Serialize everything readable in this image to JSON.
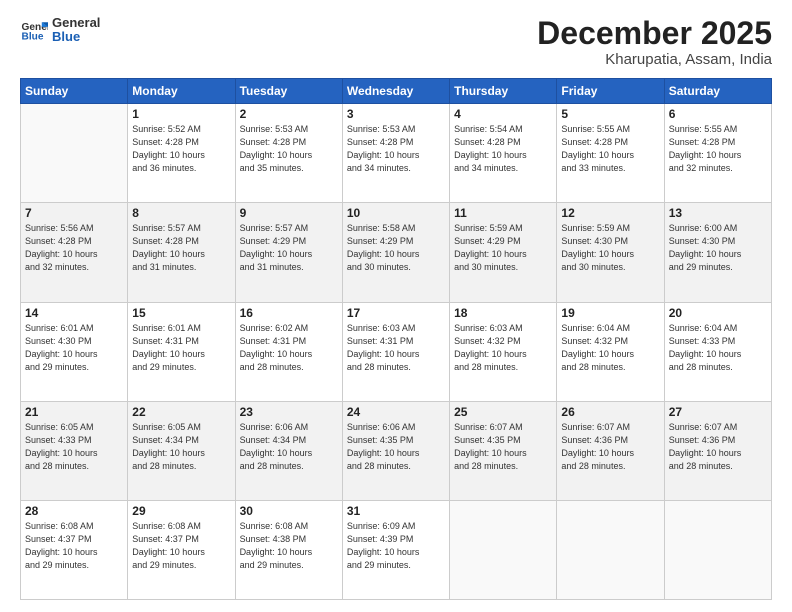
{
  "logo": {
    "line1": "General",
    "line2": "Blue"
  },
  "header": {
    "month": "December 2025",
    "location": "Kharupatia, Assam, India"
  },
  "weekdays": [
    "Sunday",
    "Monday",
    "Tuesday",
    "Wednesday",
    "Thursday",
    "Friday",
    "Saturday"
  ],
  "weeks": [
    [
      {
        "day": "",
        "info": ""
      },
      {
        "day": "1",
        "info": "Sunrise: 5:52 AM\nSunset: 4:28 PM\nDaylight: 10 hours\nand 36 minutes."
      },
      {
        "day": "2",
        "info": "Sunrise: 5:53 AM\nSunset: 4:28 PM\nDaylight: 10 hours\nand 35 minutes."
      },
      {
        "day": "3",
        "info": "Sunrise: 5:53 AM\nSunset: 4:28 PM\nDaylight: 10 hours\nand 34 minutes."
      },
      {
        "day": "4",
        "info": "Sunrise: 5:54 AM\nSunset: 4:28 PM\nDaylight: 10 hours\nand 34 minutes."
      },
      {
        "day": "5",
        "info": "Sunrise: 5:55 AM\nSunset: 4:28 PM\nDaylight: 10 hours\nand 33 minutes."
      },
      {
        "day": "6",
        "info": "Sunrise: 5:55 AM\nSunset: 4:28 PM\nDaylight: 10 hours\nand 32 minutes."
      }
    ],
    [
      {
        "day": "7",
        "info": "Sunrise: 5:56 AM\nSunset: 4:28 PM\nDaylight: 10 hours\nand 32 minutes."
      },
      {
        "day": "8",
        "info": "Sunrise: 5:57 AM\nSunset: 4:28 PM\nDaylight: 10 hours\nand 31 minutes."
      },
      {
        "day": "9",
        "info": "Sunrise: 5:57 AM\nSunset: 4:29 PM\nDaylight: 10 hours\nand 31 minutes."
      },
      {
        "day": "10",
        "info": "Sunrise: 5:58 AM\nSunset: 4:29 PM\nDaylight: 10 hours\nand 30 minutes."
      },
      {
        "day": "11",
        "info": "Sunrise: 5:59 AM\nSunset: 4:29 PM\nDaylight: 10 hours\nand 30 minutes."
      },
      {
        "day": "12",
        "info": "Sunrise: 5:59 AM\nSunset: 4:30 PM\nDaylight: 10 hours\nand 30 minutes."
      },
      {
        "day": "13",
        "info": "Sunrise: 6:00 AM\nSunset: 4:30 PM\nDaylight: 10 hours\nand 29 minutes."
      }
    ],
    [
      {
        "day": "14",
        "info": "Sunrise: 6:01 AM\nSunset: 4:30 PM\nDaylight: 10 hours\nand 29 minutes."
      },
      {
        "day": "15",
        "info": "Sunrise: 6:01 AM\nSunset: 4:31 PM\nDaylight: 10 hours\nand 29 minutes."
      },
      {
        "day": "16",
        "info": "Sunrise: 6:02 AM\nSunset: 4:31 PM\nDaylight: 10 hours\nand 28 minutes."
      },
      {
        "day": "17",
        "info": "Sunrise: 6:03 AM\nSunset: 4:31 PM\nDaylight: 10 hours\nand 28 minutes."
      },
      {
        "day": "18",
        "info": "Sunrise: 6:03 AM\nSunset: 4:32 PM\nDaylight: 10 hours\nand 28 minutes."
      },
      {
        "day": "19",
        "info": "Sunrise: 6:04 AM\nSunset: 4:32 PM\nDaylight: 10 hours\nand 28 minutes."
      },
      {
        "day": "20",
        "info": "Sunrise: 6:04 AM\nSunset: 4:33 PM\nDaylight: 10 hours\nand 28 minutes."
      }
    ],
    [
      {
        "day": "21",
        "info": "Sunrise: 6:05 AM\nSunset: 4:33 PM\nDaylight: 10 hours\nand 28 minutes."
      },
      {
        "day": "22",
        "info": "Sunrise: 6:05 AM\nSunset: 4:34 PM\nDaylight: 10 hours\nand 28 minutes."
      },
      {
        "day": "23",
        "info": "Sunrise: 6:06 AM\nSunset: 4:34 PM\nDaylight: 10 hours\nand 28 minutes."
      },
      {
        "day": "24",
        "info": "Sunrise: 6:06 AM\nSunset: 4:35 PM\nDaylight: 10 hours\nand 28 minutes."
      },
      {
        "day": "25",
        "info": "Sunrise: 6:07 AM\nSunset: 4:35 PM\nDaylight: 10 hours\nand 28 minutes."
      },
      {
        "day": "26",
        "info": "Sunrise: 6:07 AM\nSunset: 4:36 PM\nDaylight: 10 hours\nand 28 minutes."
      },
      {
        "day": "27",
        "info": "Sunrise: 6:07 AM\nSunset: 4:36 PM\nDaylight: 10 hours\nand 28 minutes."
      }
    ],
    [
      {
        "day": "28",
        "info": "Sunrise: 6:08 AM\nSunset: 4:37 PM\nDaylight: 10 hours\nand 29 minutes."
      },
      {
        "day": "29",
        "info": "Sunrise: 6:08 AM\nSunset: 4:37 PM\nDaylight: 10 hours\nand 29 minutes."
      },
      {
        "day": "30",
        "info": "Sunrise: 6:08 AM\nSunset: 4:38 PM\nDaylight: 10 hours\nand 29 minutes."
      },
      {
        "day": "31",
        "info": "Sunrise: 6:09 AM\nSunset: 4:39 PM\nDaylight: 10 hours\nand 29 minutes."
      },
      {
        "day": "",
        "info": ""
      },
      {
        "day": "",
        "info": ""
      },
      {
        "day": "",
        "info": ""
      }
    ]
  ]
}
